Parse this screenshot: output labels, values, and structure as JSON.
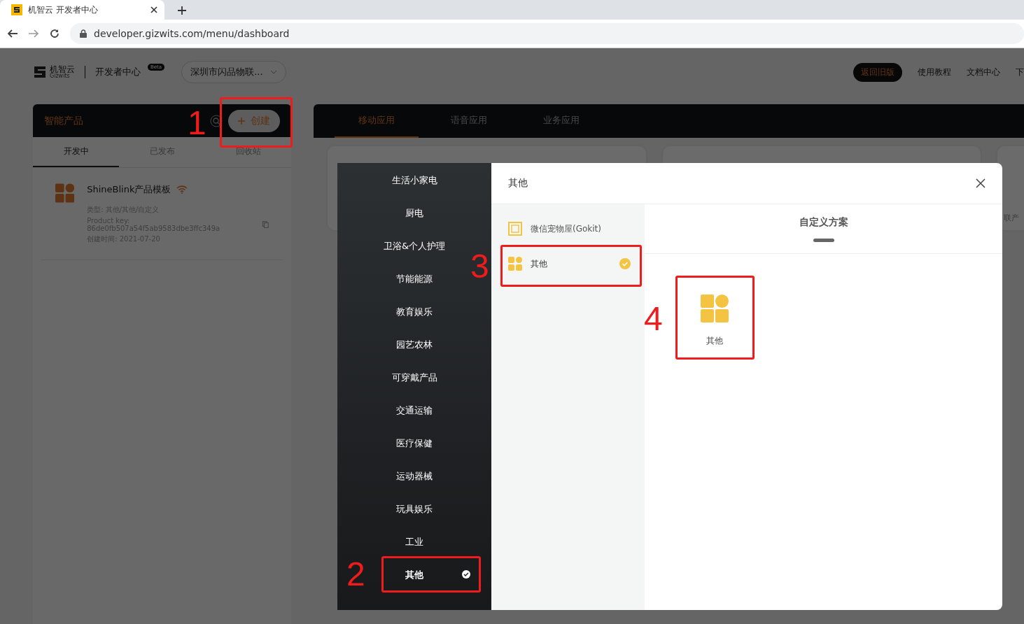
{
  "browser": {
    "tab_title": "机智云 开发者中心",
    "url": "developer.gizwits.com/menu/dashboard"
  },
  "header": {
    "logo_text": "机智云",
    "logo_sub": "Gizwits",
    "title": "开发者中心",
    "badge": "Beta",
    "org_select": "深圳市闪品物联...",
    "nav": [
      {
        "label": "返回旧版",
        "kind": "pill"
      },
      {
        "label": "使用教程",
        "kind": "link"
      },
      {
        "label": "文档中心",
        "kind": "link"
      },
      {
        "label": "下",
        "kind": "link"
      }
    ]
  },
  "products_panel": {
    "title": "智能产品",
    "create_button": "创建",
    "tabs": [
      {
        "label": "开发中",
        "selected": true
      },
      {
        "label": "已发布",
        "selected": false
      },
      {
        "label": "回收站",
        "selected": false
      }
    ],
    "products": [
      {
        "name": "ShineBlink产品模板",
        "type": "类型: 其他/其他/自定义",
        "key": "Product key: 86de0fb507a54f5ab9583dbe3ffc349a",
        "created": "创建时间: 2021-07-20"
      }
    ]
  },
  "apps_panel": {
    "tabs": [
      {
        "label": "移动应用",
        "selected": true
      },
      {
        "label": "语音应用",
        "selected": false
      },
      {
        "label": "业务应用",
        "selected": false
      }
    ],
    "card_text": "联产"
  },
  "modal": {
    "title": "其他",
    "categories": [
      {
        "label": "生活小家电",
        "selected": false
      },
      {
        "label": "厨电",
        "selected": false
      },
      {
        "label": "卫浴&个人护理",
        "selected": false
      },
      {
        "label": "节能能源",
        "selected": false
      },
      {
        "label": "教育娱乐",
        "selected": false
      },
      {
        "label": "园艺农林",
        "selected": false
      },
      {
        "label": "可穿戴产品",
        "selected": false
      },
      {
        "label": "交通运输",
        "selected": false
      },
      {
        "label": "医疗保健",
        "selected": false
      },
      {
        "label": "运动器械",
        "selected": false
      },
      {
        "label": "玩具娱乐",
        "selected": false
      },
      {
        "label": "工业",
        "selected": false
      },
      {
        "label": "其他",
        "selected": true
      }
    ],
    "templates": [
      {
        "label": "微信宠物屋(Gokit)",
        "kind": "frame",
        "selected": false
      },
      {
        "label": "其他",
        "kind": "blocks",
        "selected": true
      }
    ],
    "solution_tabs": [
      {
        "label": "自定义方案",
        "selected": true
      }
    ],
    "solutions": [
      {
        "label": "其他"
      }
    ]
  },
  "annotations": [
    "1",
    "2",
    "3",
    "4"
  ]
}
